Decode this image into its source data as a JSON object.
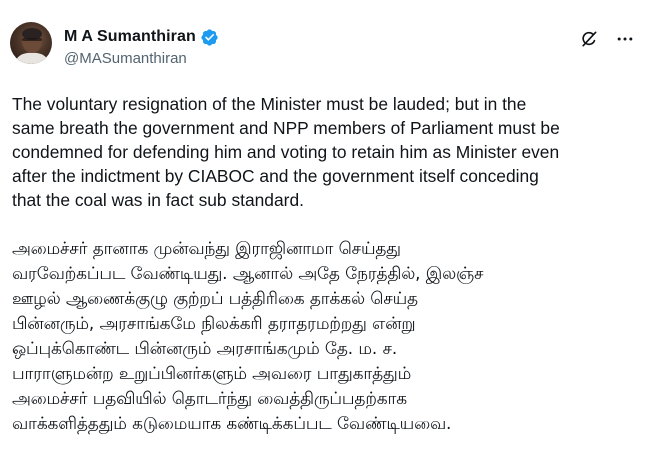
{
  "author": {
    "display_name": "M A Sumanthiran",
    "handle": "@MASumanthiran",
    "verified": true,
    "verified_color": "#1d9bf0"
  },
  "actions": {
    "icons": [
      "grok-icon",
      "more-options-icon"
    ]
  },
  "tweet": {
    "paragraph_en": "The voluntary resignation of the Minister must be lauded; but in the\nsame breath the government and NPP members of Parliament must be\ncondemned for defending him and voting to retain him as Minister even\nafter the indictment by CIABOC and the government itself conceding\nthat the coal was in fact sub standard.",
    "paragraph_ta": "அமைச்சர் தானாக முன்வந்து இராஜினாமா செய்தது\nவரவேற்கப்பட வேண்டியது. ஆனால் அதே நேரத்தில், இலஞ்ச\nஊழல் ஆணைக்குழு குற்றப் பத்திரிகை தாக்கல் செய்த\nபின்னரும், அரசாங்கமே நிலக்கரி தராதரமற்றது என்று\nஒப்புக்கொண்ட பின்னரும் அரசாங்கமும் தே. ம. ச.\nபாராளுமன்ற உறுப்பினர்களும் அவரை பாதுகாத்தும்\nஅமைச்சர் பதவியில் தொடர்ந்து வைத்திருப்பதற்காக\nவாக்களித்ததும் கடுமையாக கண்டிக்கப்பட வேண்டியவை."
  }
}
